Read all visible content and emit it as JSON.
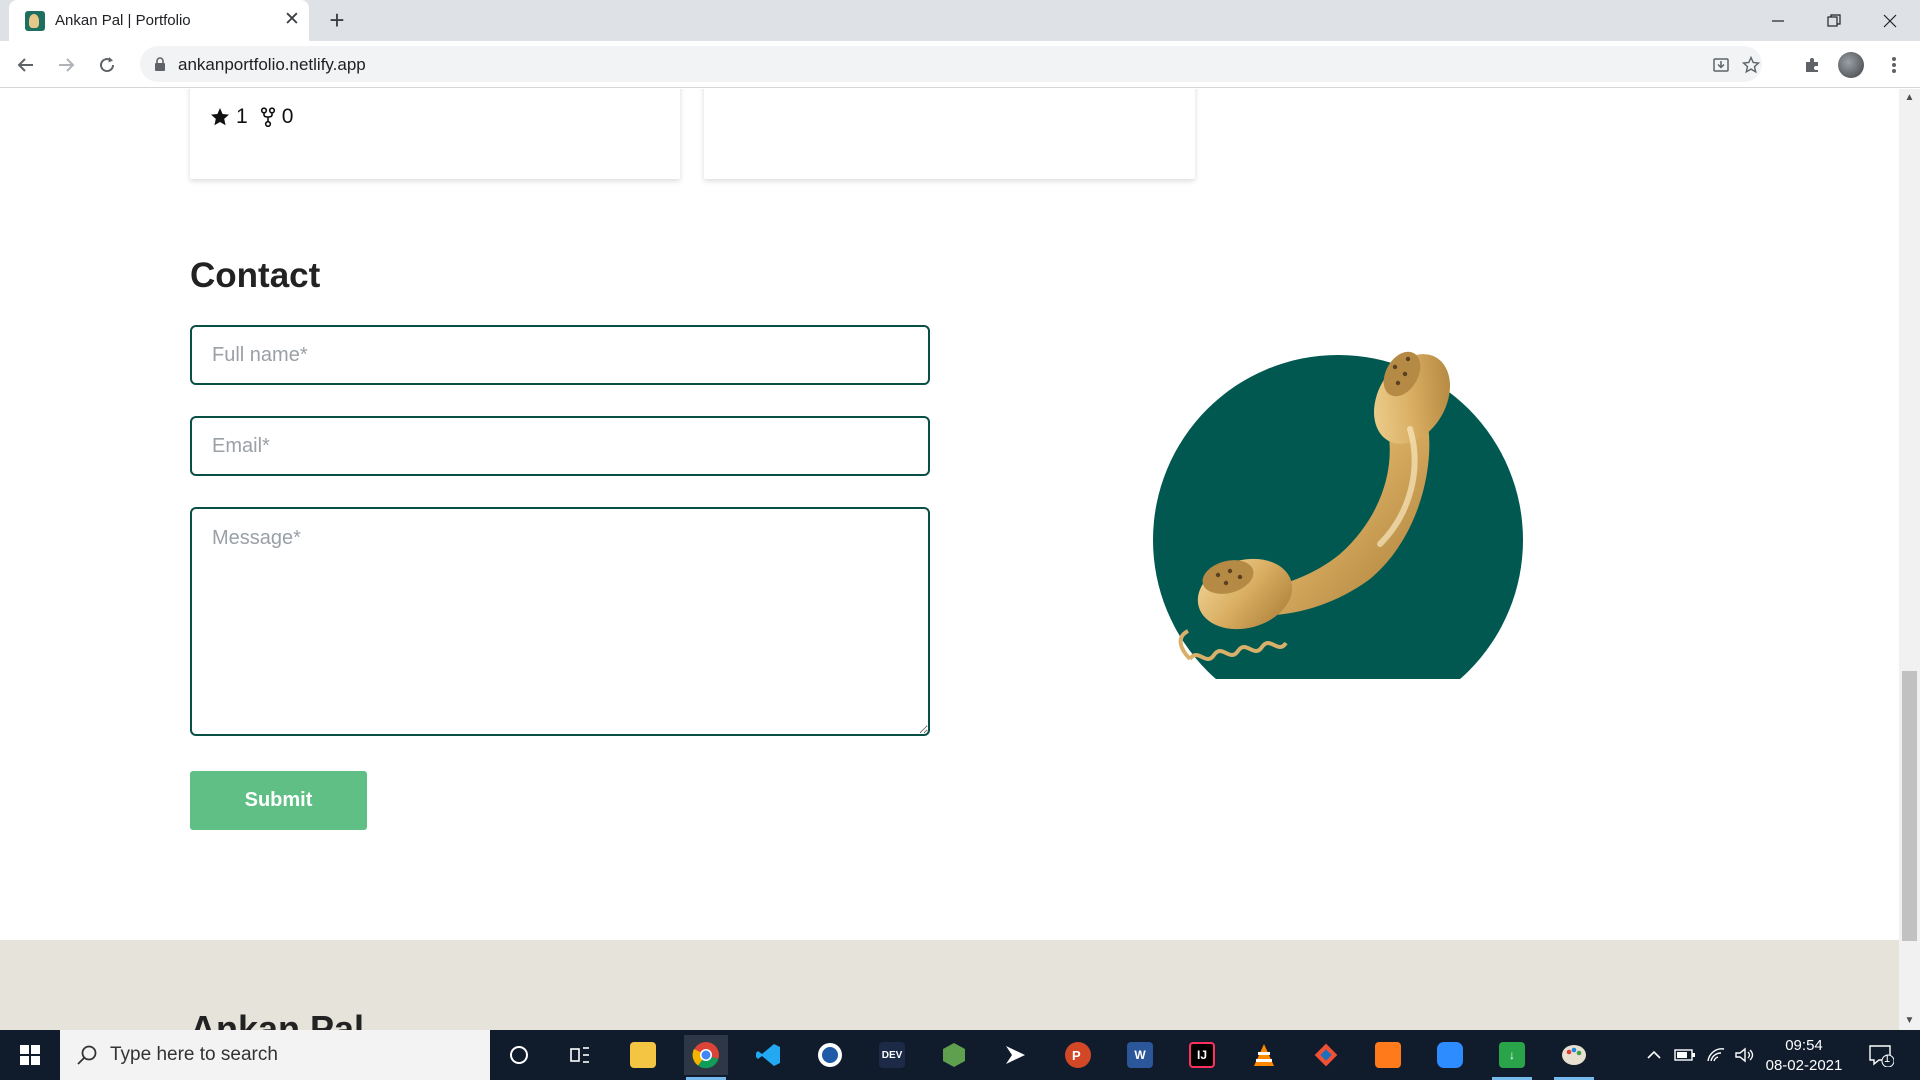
{
  "browser": {
    "tab_title": "Ankan Pal | Portfolio",
    "new_tab": "+",
    "url": "ankanportfolio.netlify.app"
  },
  "cards": [
    {
      "stars": "1",
      "forks": "0"
    }
  ],
  "contact": {
    "title": "Contact",
    "name_placeholder": "Full name*",
    "email_placeholder": "Email*",
    "message_placeholder": "Message*",
    "submit_label": "Submit"
  },
  "footer": {
    "name": "Ankan Pal"
  },
  "colors": {
    "accent_dark": "#0a4f46",
    "submit_green": "#5fbf85",
    "footer_bg": "#e5e3da"
  },
  "taskbar": {
    "search_placeholder": "Type here to search",
    "time": "09:54",
    "date": "08-02-2021",
    "notification_count": "1",
    "apps": [
      "cortana-icon",
      "task-view-icon",
      "file-explorer-icon",
      "chrome-icon",
      "vscode-icon",
      "app-w-icon",
      "devc-icon",
      "nodejs-icon",
      "terminal-icon",
      "powerpoint-icon",
      "word-icon",
      "intellij-icon",
      "vlc-icon",
      "git-icon",
      "sublime-icon",
      "zoom-icon",
      "cloud-download-icon",
      "paint-icon"
    ]
  }
}
